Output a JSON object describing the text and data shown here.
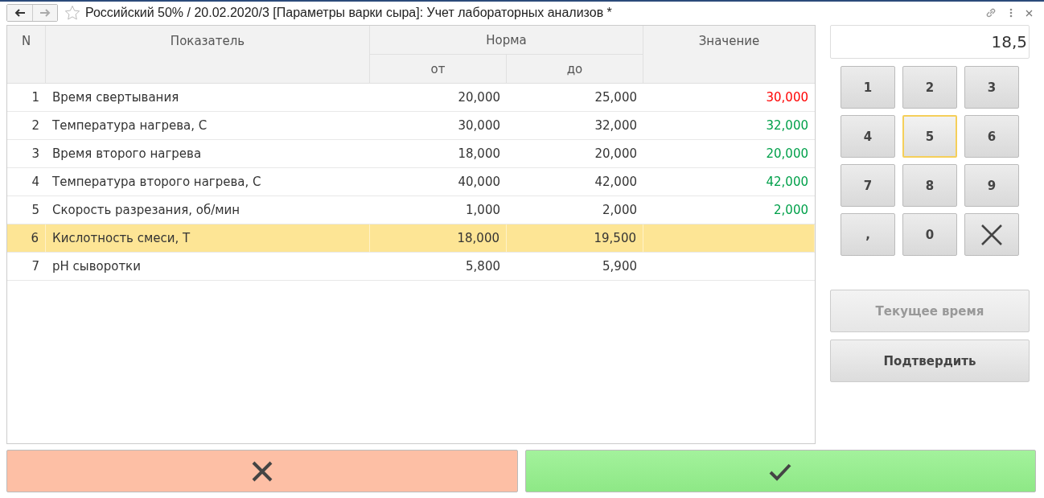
{
  "window": {
    "title": "Российский 50% / 20.02.2020/3 [Параметры варки сыра]: Учет лабораторных анализов *"
  },
  "table": {
    "columns": {
      "n": "N",
      "name": "Показатель",
      "norm": "Норма",
      "from": "от",
      "to": "до",
      "value": "Значение"
    },
    "rows": [
      {
        "n": "1",
        "name": "Время свертывания",
        "from": "20,000",
        "to": "25,000",
        "value": "30,000",
        "color": "#ff0000",
        "selected": false
      },
      {
        "n": "2",
        "name": "Температура нагрева, С",
        "from": "30,000",
        "to": "32,000",
        "value": "32,000",
        "color": "#00a04a",
        "selected": false
      },
      {
        "n": "3",
        "name": "Время второго нагрева",
        "from": "18,000",
        "to": "20,000",
        "value": "20,000",
        "color": "#00a04a",
        "selected": false
      },
      {
        "n": "4",
        "name": "Температура второго нагрева, С",
        "from": "40,000",
        "to": "42,000",
        "value": "42,000",
        "color": "#00a04a",
        "selected": false
      },
      {
        "n": "5",
        "name": "Скорость разрезания, об/мин",
        "from": "1,000",
        "to": "2,000",
        "value": "2,000",
        "color": "#00a04a",
        "selected": false
      },
      {
        "n": "6",
        "name": "Кислотность смеси, Т",
        "from": "18,000",
        "to": "19,500",
        "selected": true
      },
      {
        "n": "7",
        "name": "pH сыворотки",
        "from": "5,800",
        "to": "5,900",
        "selected": false
      }
    ]
  },
  "keypad": {
    "display": "18,5",
    "keys": [
      {
        "kind": "digit",
        "label": "1",
        "focused": false
      },
      {
        "kind": "digit",
        "label": "2",
        "focused": false
      },
      {
        "kind": "digit",
        "label": "3",
        "focused": false
      },
      {
        "kind": "digit",
        "label": "4",
        "focused": false
      },
      {
        "kind": "digit",
        "label": "5",
        "focused": true
      },
      {
        "kind": "digit",
        "label": "6",
        "focused": false
      },
      {
        "kind": "digit",
        "label": "7",
        "focused": false
      },
      {
        "kind": "digit",
        "label": "8",
        "focused": false
      },
      {
        "kind": "digit",
        "label": "9",
        "focused": false
      },
      {
        "kind": "digit",
        "label": ",",
        "focused": false
      },
      {
        "kind": "digit",
        "label": "0",
        "focused": false
      },
      {
        "kind": "clear",
        "focused": false
      }
    ]
  },
  "actions": [
    {
      "label": "Текущее время",
      "disabled": true
    },
    {
      "label": "Подтвердить",
      "disabled": false
    }
  ],
  "footer": [
    {
      "kind": "cancel"
    },
    {
      "kind": "ok"
    }
  ]
}
